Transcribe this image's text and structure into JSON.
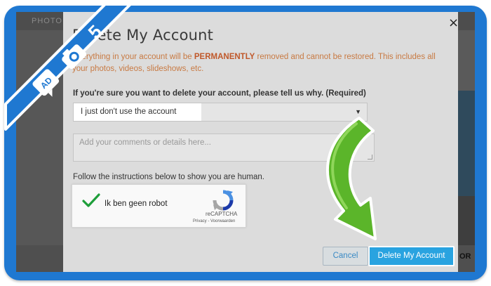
{
  "background": {
    "top_label": "PHOTO",
    "right_text": "OR"
  },
  "modal": {
    "title": "Delete My Account",
    "warning_pre": "Everything in your account will be ",
    "warning_strong": "PERMANENTLY",
    "warning_post": " removed and cannot be restored. This includes all your photos, videos, slideshows, etc.",
    "reason_label": "If you're sure you want to delete your account, please tell us why. (Required)",
    "reason_selected": "I just don't use the account",
    "comments_placeholder": "Add your comments or details here...",
    "human_instructions": "Follow the instructions below to show you are human.",
    "captcha": {
      "label": "Ik ben geen robot",
      "brand": "reCAPTCHA",
      "links": "Privacy - Voorwaarden",
      "checked": true
    },
    "cancel_label": "Cancel",
    "delete_label": "Delete My Account",
    "close_glyph": "×"
  },
  "badge": {
    "step_number": "5",
    "logo_text": "AD",
    "icon": "camera-icon"
  },
  "colors": {
    "frame_blue": "#1f78d1",
    "warning_orange": "#c87a43",
    "delete_button": "#29a3e0",
    "arrow_green": "#5bb52a"
  }
}
